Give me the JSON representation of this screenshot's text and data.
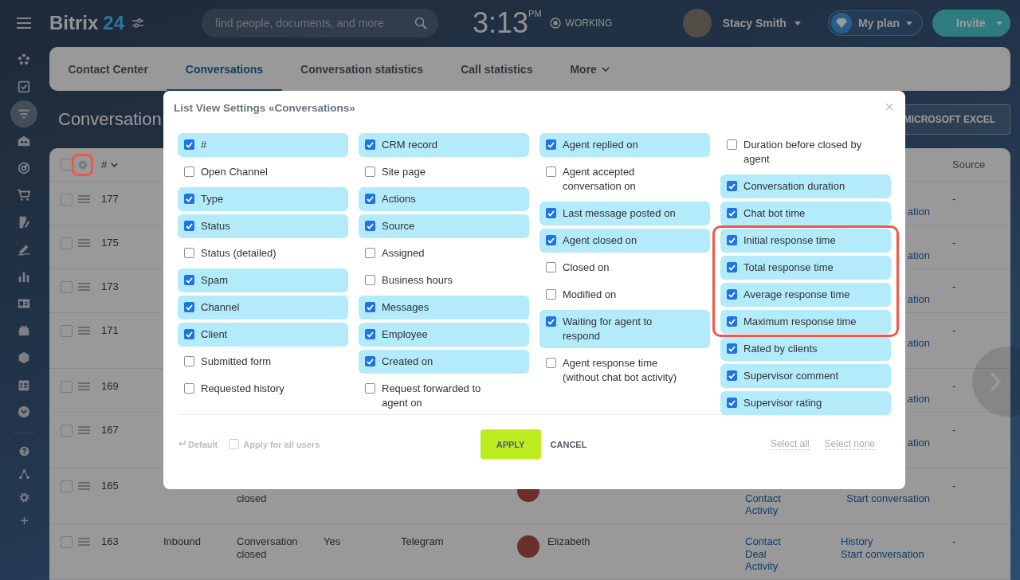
{
  "header": {
    "logo_word": "Bitrix",
    "logo_number": "24",
    "search": {
      "placeholder": "find people, documents, and more"
    },
    "clock": {
      "time": "3:13",
      "period": "PM"
    },
    "work_status": "WORKING",
    "user": {
      "name": "Stacy Smith"
    },
    "plan": "My plan",
    "invite": "Invite"
  },
  "sidebar": {
    "items": [
      {
        "selected": false
      },
      {
        "selected": false
      },
      {
        "selected": true
      },
      {
        "selected": false
      },
      {
        "selected": false
      },
      {
        "selected": false
      },
      {
        "selected": false
      },
      {
        "selected": false
      },
      {
        "selected": false
      },
      {
        "selected": false
      },
      {
        "selected": false
      },
      {
        "selected": false
      },
      {
        "selected": false
      },
      {
        "selected": false
      },
      {
        "selected": false
      },
      {
        "selected": false
      },
      {
        "selected": false
      },
      {
        "selected": false
      }
    ]
  },
  "tabs": [
    {
      "label": "Contact Center",
      "selected": false,
      "kind": "link"
    },
    {
      "label": "Conversations",
      "selected": true,
      "kind": "link"
    },
    {
      "label": "Conversation statistics",
      "selected": false,
      "kind": "link"
    },
    {
      "label": "Call statistics",
      "selected": false,
      "kind": "link"
    },
    {
      "label": "More",
      "selected": false,
      "kind": "menu"
    }
  ],
  "page_title": "Conversation",
  "export_button": "MICROSOFT EXCEL",
  "table": {
    "header": {
      "all_checked": false,
      "settings_highlighted": true,
      "number": "#",
      "source": "Source"
    },
    "rows": [
      {
        "number": "177",
        "checked": false,
        "cut": true,
        "actions": [
          "ation"
        ],
        "source": "-"
      },
      {
        "number": "175",
        "checked": false,
        "cut": true,
        "actions": [
          "ation"
        ],
        "source": "-"
      },
      {
        "number": "173",
        "checked": false,
        "cut": true,
        "actions": [
          "ation"
        ],
        "source": "-"
      },
      {
        "number": "171",
        "checked": false,
        "cut": true,
        "actions": [
          "ation"
        ],
        "source": "-"
      },
      {
        "number": "169",
        "checked": false,
        "cut": true,
        "actions": [
          "ation"
        ],
        "source": "-"
      },
      {
        "number": "167",
        "checked": false,
        "cut": true,
        "actions": [
          "ation"
        ],
        "source": "-"
      },
      {
        "number": "165",
        "checked": false,
        "cut": true,
        "status": "closed",
        "avatar": true,
        "entities": [
          "Contact",
          "Activity"
        ],
        "actions": [
          "Start conversation"
        ],
        "source": "-"
      },
      {
        "number": "163",
        "checked": false,
        "cut": false,
        "direction": "Inbound",
        "status": "Conversation closed",
        "answered": "Yes",
        "channel": "Telegram",
        "avatar": true,
        "agent": "Elizabeth",
        "entities": [
          "Contact",
          "Deal",
          "Activity"
        ],
        "actions": [
          "History",
          "Start conversation"
        ],
        "source": "-"
      }
    ]
  },
  "modal": {
    "title": "List View Settings «Conversations»",
    "close": "×",
    "columns": [
      [
        {
          "kind": "option",
          "label": "#",
          "checked": true
        },
        {
          "kind": "option",
          "label": "Open Channel",
          "checked": false
        },
        {
          "kind": "option",
          "label": "Type",
          "checked": true
        },
        {
          "kind": "option",
          "label": "Status",
          "checked": true
        },
        {
          "kind": "option",
          "label": "Status (detailed)",
          "checked": false
        },
        {
          "kind": "option",
          "label": "Spam",
          "checked": true
        },
        {
          "kind": "option",
          "label": "Channel",
          "checked": true
        },
        {
          "kind": "option",
          "label": "Client",
          "checked": true
        },
        {
          "kind": "option",
          "label": "Submitted form",
          "checked": false
        },
        {
          "kind": "option",
          "label": "Requested history",
          "checked": false
        }
      ],
      [
        {
          "kind": "option",
          "label": "CRM record",
          "checked": true
        },
        {
          "kind": "option",
          "label": "Site page",
          "checked": false
        },
        {
          "kind": "option",
          "label": "Actions",
          "checked": true
        },
        {
          "kind": "option",
          "label": "Source",
          "checked": true
        },
        {
          "kind": "option",
          "label": "Assigned",
          "checked": false
        },
        {
          "kind": "option",
          "label": "Business hours",
          "checked": false
        },
        {
          "kind": "option",
          "label": "Messages",
          "checked": true
        },
        {
          "kind": "option",
          "label": "Employee",
          "checked": true
        },
        {
          "kind": "option",
          "label": "Created on",
          "checked": true
        },
        {
          "kind": "option",
          "label": "Request forwarded to agent on",
          "checked": false
        }
      ],
      [
        {
          "kind": "option",
          "label": "Agent replied on",
          "checked": true
        },
        {
          "kind": "option",
          "label": "Agent accepted conversation on",
          "checked": false
        },
        {
          "kind": "option",
          "label": "Last message posted on",
          "checked": true
        },
        {
          "kind": "option",
          "label": "Agent closed on",
          "checked": true
        },
        {
          "kind": "option",
          "label": "Closed on",
          "checked": false
        },
        {
          "kind": "option",
          "label": "Modified on",
          "checked": false
        },
        {
          "kind": "option",
          "label": "Waiting for agent to respond",
          "checked": true
        },
        {
          "kind": "option",
          "label": "Agent response time (without chat bot activity)",
          "checked": false
        }
      ],
      [
        {
          "kind": "option",
          "label": "Duration before closed by agent",
          "checked": false
        },
        {
          "kind": "option",
          "label": "Conversation duration",
          "checked": true
        },
        {
          "kind": "option",
          "label": "Chat bot time",
          "checked": true
        },
        {
          "kind": "highlight",
          "options": [
            {
              "label": "Initial response time",
              "checked": true
            },
            {
              "label": "Total response time",
              "checked": true
            },
            {
              "label": "Average response time",
              "checked": true
            },
            {
              "label": "Maximum response time",
              "checked": true
            }
          ]
        },
        {
          "kind": "option",
          "label": "Rated by clients",
          "checked": true
        },
        {
          "kind": "option",
          "label": "Supervisor comment",
          "checked": true
        },
        {
          "kind": "option",
          "label": "Supervisor rating",
          "checked": true
        }
      ]
    ],
    "footer": {
      "default": "Default",
      "apply_all": {
        "label": "Apply for all users",
        "checked": false
      },
      "apply": "APPLY",
      "cancel": "CANCEL",
      "select_all": "Select all",
      "select_none": "Select none"
    }
  }
}
